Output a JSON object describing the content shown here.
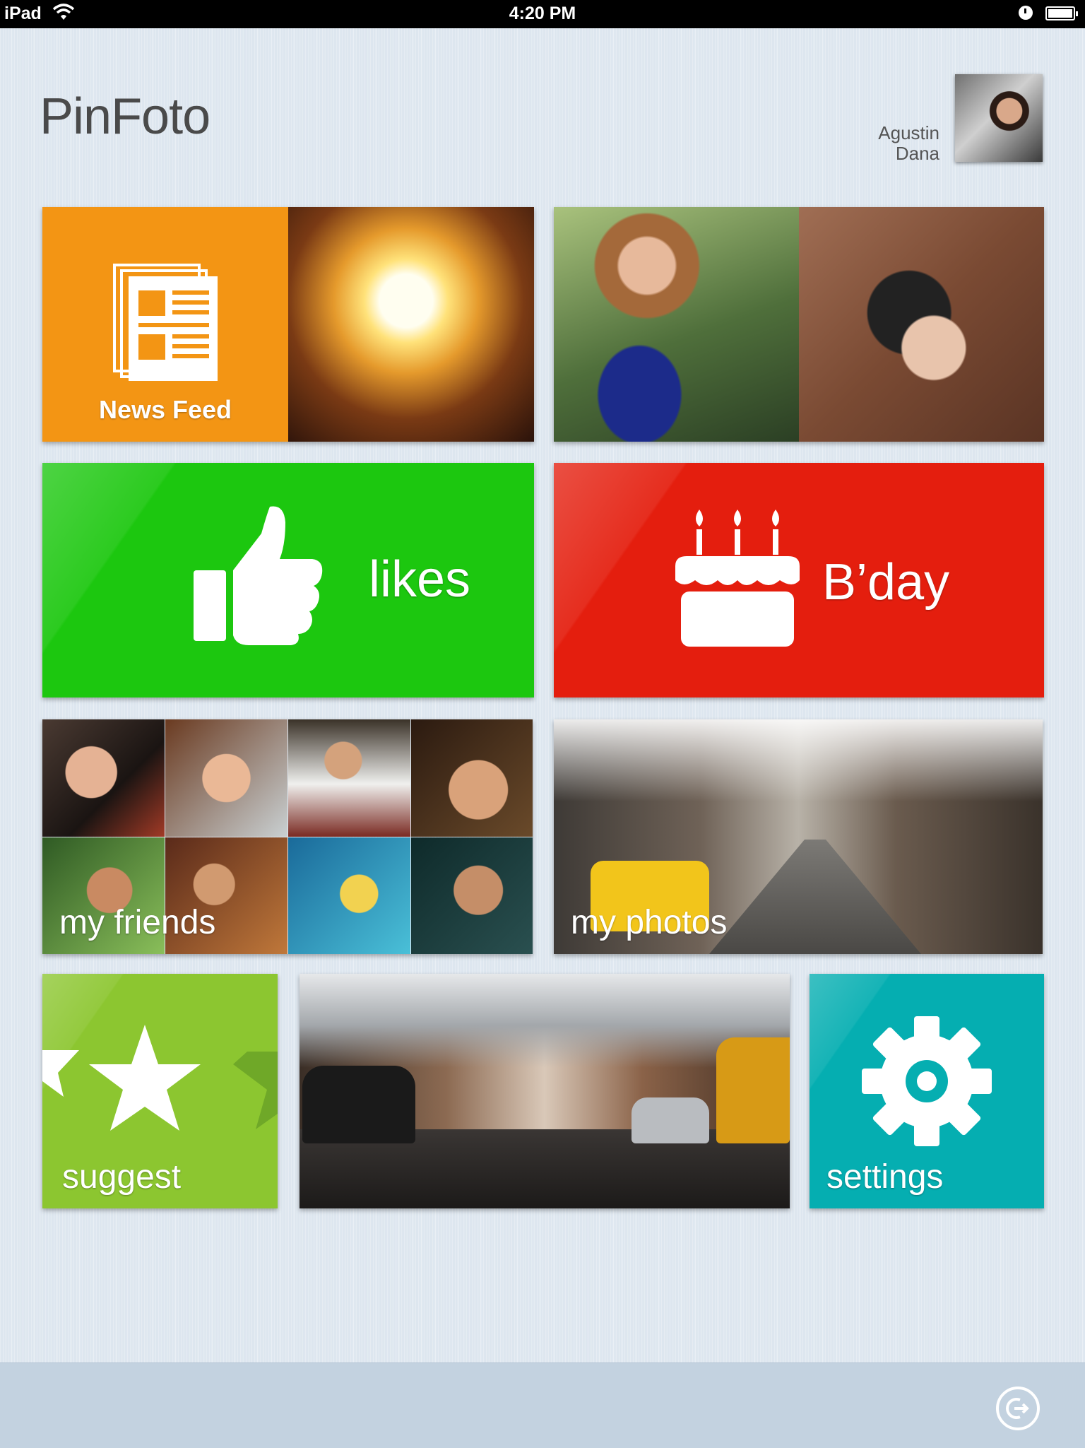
{
  "status_bar": {
    "carrier": "iPad",
    "time": "4:20 PM",
    "wifi_icon": "wifi-icon",
    "battery_icon": "battery-icon"
  },
  "header": {
    "app_title": "PinFoto",
    "user_first_name": "Agustin",
    "user_last_name": "Dana"
  },
  "tiles": {
    "news_feed": {
      "label": "News Feed",
      "color": "#f39514",
      "icon": "newspaper-icon"
    },
    "likes": {
      "label": "likes",
      "color": "#1cc70f",
      "icon": "thumbs-up-icon"
    },
    "bday": {
      "label": "B’day",
      "color": "#e41e0e",
      "icon": "birthday-cake-icon"
    },
    "friends": {
      "label": "my friends"
    },
    "photos": {
      "label": "my photos"
    },
    "suggest": {
      "label": "suggest",
      "color": "#8cc630",
      "icon": "star-icon"
    },
    "settings": {
      "label": "settings",
      "color": "#05aeb1",
      "icon": "gear-icon"
    }
  },
  "footer": {
    "logout_icon": "logout-icon"
  }
}
